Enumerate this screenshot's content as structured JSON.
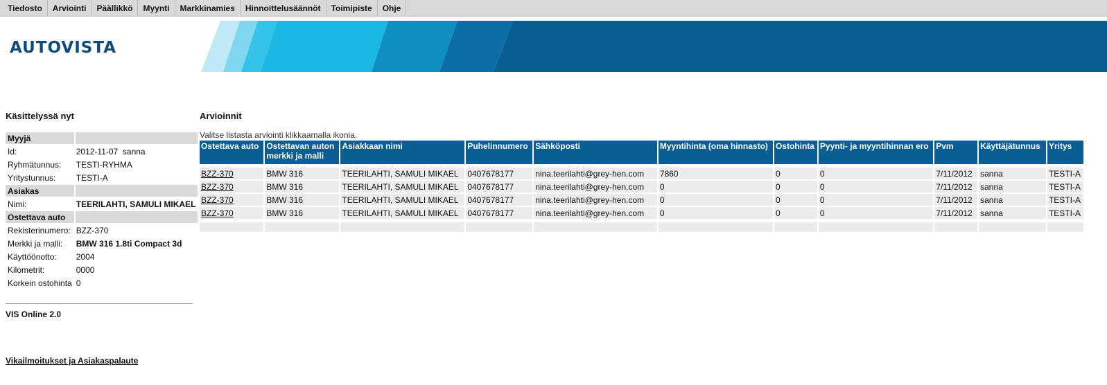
{
  "menu": [
    "Tiedosto",
    "Arviointi",
    "Päällikkö",
    "Myynti",
    "Markkinamies",
    "Hinnoittelusäännöt",
    "Toimipiste",
    "Ohje"
  ],
  "brand": {
    "logo": "AUTOVISTA",
    "banner_colors": [
      "#bfe9f5",
      "#7fd6ee",
      "#33c3e6",
      "#1ab8e3",
      "#0f8ec0",
      "#0b6ea6",
      "#0a5e94"
    ]
  },
  "sidebar": {
    "title": "Käsittelyssä nyt",
    "seller_header": "Myyjä",
    "id_label": "Id:",
    "id_value": "2012-11-07  sanna",
    "group_label": "Ryhmätunnus:",
    "group_value": "TESTI-RYHMA",
    "company_label": "Yritystunnus:",
    "company_value": "TESTI-A",
    "customer_header": "Asiakas",
    "name_label": "Nimi:",
    "name_value": "TEERILAHTI, SAMULI MIKAEL",
    "car_header": "Ostettava auto",
    "reg_label": "Rekisterinumero:",
    "reg_value": "BZZ-370",
    "model_label": "Merkki ja malli:",
    "model_value": "BMW 316 1.8ti Compact 3d",
    "year_label": "Käyttöönotto:",
    "year_value": "2004",
    "km_label": "Kilometrit:",
    "km_value": "0000",
    "maxprice_label": "Korkein ostohinta",
    "maxprice_value": "0",
    "version": "VIS Online 2.0",
    "feedback_link": "Vikailmoitukset ja Asiakaspalaute"
  },
  "main": {
    "title": "Arvioinnit",
    "instruction": "Valitse listasta arviointi klikkaamalla ikonia.",
    "columns": [
      "Ostettava auto",
      "Ostettavan auton merkki ja malli",
      "Asiakkaan nimi",
      "Puhelinnumero",
      "Sähköposti",
      "Myyntihinta (oma hinnasto)",
      "Ostohinta",
      "Pyynti- ja myyntihinnan ero",
      "Pvm",
      "Käyttäjätunnus",
      "Yritys"
    ],
    "rows": [
      [
        "BZZ-370",
        "BMW 316",
        "TEERILAHTI, SAMULI MIKAEL",
        "0407678177",
        "nina.teerilahti@grey-hen.com",
        "7860",
        "0",
        "0",
        "7/11/2012",
        "sanna",
        "TESTI-A"
      ],
      [
        "BZZ-370",
        "BMW 316",
        "TEERILAHTI, SAMULI MIKAEL",
        "0407678177",
        "nina.teerilahti@grey-hen.com",
        "0",
        "0",
        "0",
        "7/11/2012",
        "sanna",
        "TESTI-A"
      ],
      [
        "BZZ-370",
        "BMW 316",
        "TEERILAHTI, SAMULI MIKAEL",
        "0407678177",
        "nina.teerilahti@grey-hen.com",
        "0",
        "0",
        "0",
        "7/11/2012",
        "sanna",
        "TESTI-A"
      ],
      [
        "BZZ-370",
        "BMW 316",
        "TEERILAHTI, SAMULI MIKAEL",
        "0407678177",
        "nina.teerilahti@grey-hen.com",
        "0",
        "0",
        "0",
        "7/11/2012",
        "sanna",
        "TESTI-A"
      ]
    ]
  }
}
